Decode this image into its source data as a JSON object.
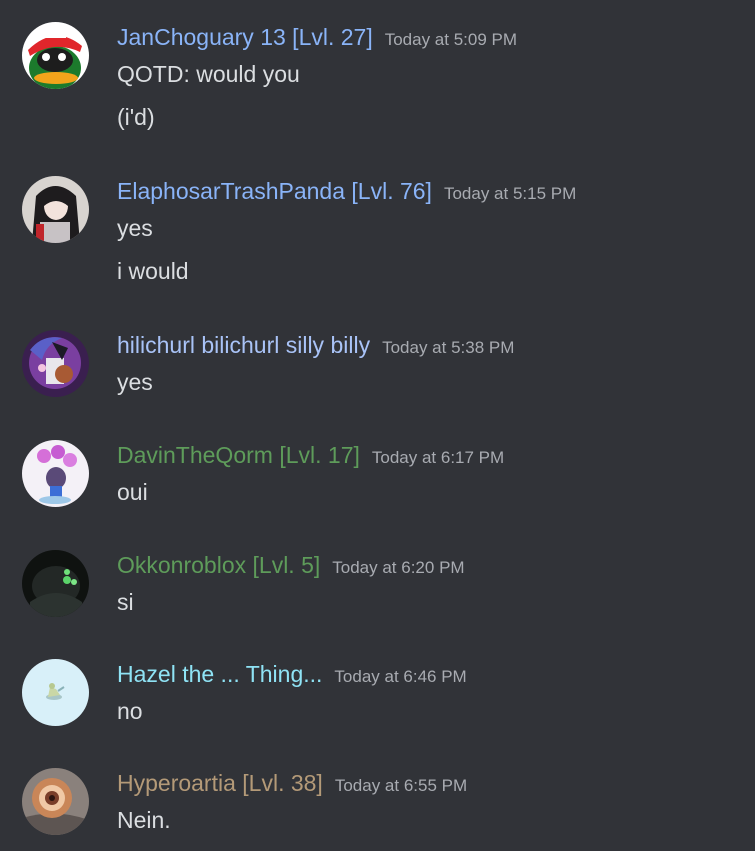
{
  "messages": [
    {
      "username": "JanChoguary 13 [Lvl. 27]",
      "username_color": "#8ab4f8",
      "timestamp": "Today at 5:09 PM",
      "avatar_icon": "penguin-with-red-cap-icon",
      "lines": [
        "QOTD: would you",
        "(i'd)"
      ]
    },
    {
      "username": "ElaphosarTrashPanda [Lvl. 76]",
      "username_color": "#8ab4f8",
      "timestamp": "Today at 5:15 PM",
      "avatar_icon": "anime-girl-avatar-icon",
      "lines": [
        "yes",
        "i would"
      ]
    },
    {
      "username": "hilichurl bilichurl silly billy",
      "username_color": "#a9c3f7",
      "timestamp": "Today at 5:38 PM",
      "avatar_icon": "purple-character-avatar-icon",
      "lines": [
        "yes"
      ]
    },
    {
      "username": "DavinTheQorm [Lvl. 17]",
      "username_color": "#5e9c5a",
      "timestamp": "Today at 6:17 PM",
      "avatar_icon": "character-with-pink-flowers-icon",
      "lines": [
        "oui"
      ]
    },
    {
      "username": "Okkonroblox [Lvl. 5]",
      "username_color": "#5e9c5a",
      "timestamp": "Today at 6:20 PM",
      "avatar_icon": "dark-robot-green-eyes-icon",
      "lines": [
        "si"
      ]
    },
    {
      "username": "Hazel the ... Thing...",
      "username_color": "#8fe3f5",
      "timestamp": "Today at 6:46 PM",
      "avatar_icon": "small-figure-light-blue-icon",
      "lines": [
        "no"
      ]
    },
    {
      "username": "Hyperoartia [Lvl. 38]",
      "username_color": "#b49a78",
      "timestamp": "Today at 6:55 PM",
      "avatar_icon": "lamprey-mouth-icon",
      "lines": [
        "Nein."
      ]
    }
  ]
}
